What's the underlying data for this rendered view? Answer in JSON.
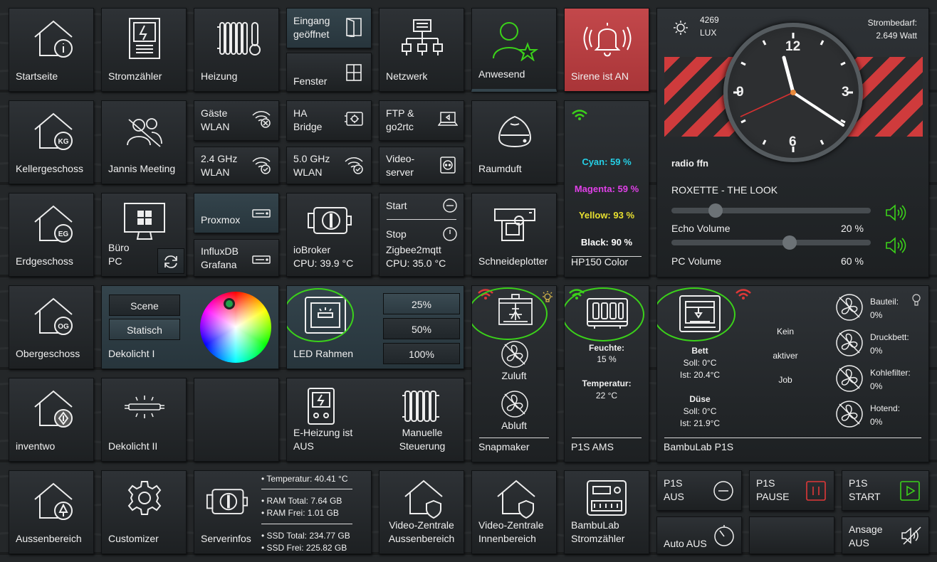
{
  "tiles": {
    "startseite": "Startseite",
    "stromzaehler": "Stromzähler",
    "heizung": "Heizung",
    "eingang": "Eingang geöffnet",
    "fenster": "Fenster",
    "netzwerk": "Netzwerk",
    "anwesend": "Anwesend",
    "sirene": "Sirene ist AN",
    "kellergeschoss": "Kellergeschoss",
    "jannis": "Jannis Meeting",
    "gaeste": "Gäste WLAN",
    "ha": "HA Bridge",
    "ftp": "FTP & go2rtc",
    "wlan24": "2.4 GHz WLAN",
    "wlan50": "5.0 GHz WLAN",
    "videoserver": "Video-server",
    "raumduft": "Raumduft",
    "erdgeschoss": "Erdgeschoss",
    "buero": "Büro PC",
    "proxmox": "Proxmox",
    "influx": "InfluxDB Grafana",
    "iobroker": "ioBroker",
    "iobroker_cpu": "CPU: 39.9 °C",
    "start": "Start",
    "stop": "Stop",
    "zigbee": "Zigbee2mqtt",
    "zigbee_cpu": "CPU: 35.0 °C",
    "schneideplotter": "Schneideplotter",
    "obergeschoss": "Obergeschoss",
    "dekolicht1": "Dekolicht I",
    "scene": "Scene",
    "statisch": "Statisch",
    "led": "LED Rahmen",
    "p25": "25%",
    "p50": "50%",
    "p100": "100%",
    "inventwo": "inventwo",
    "dekolicht2": "Dekolicht II",
    "eheizung": "E-Heizung ist AUS",
    "manuell": "Manuelle Steuerung",
    "aussenbereich": "Aussenbereich",
    "customizer": "Customizer",
    "serverinfos": "Serverinfos",
    "vz_aussen": "Video-Zentrale Aussenbereich",
    "vz_innen": "Video-Zentrale Innenbereich",
    "bambu_strom": "BambuLab Stromzähler"
  },
  "printer": {
    "cyan": "Cyan: 59 %",
    "magenta": "Magenta: 59 %",
    "yellow": "Yellow: 93 %",
    "black": "Black: 90 %",
    "name": "HP150 Color"
  },
  "radio": {
    "lux_value": "4269",
    "lux_unit": "LUX",
    "power_label": "Strombedarf:",
    "power_value": "2.649 Watt",
    "station": "radio ffn",
    "track": "ROXETTE - THE LOOK",
    "echo_label": "Echo Volume",
    "echo_value": "20 %",
    "echo_level": 0.2,
    "pc_label": "PC Volume",
    "pc_value": "60 %",
    "pc_level": 0.6,
    "clock_12": "12",
    "clock_3": "3",
    "clock_6": "6",
    "clock_9": "9"
  },
  "snapmaker": {
    "zuluft": "Zuluft",
    "abluft": "Abluft",
    "name": "Snapmaker"
  },
  "ams": {
    "feuchte_label": "Feuchte:",
    "feuchte_value": "15 %",
    "temp_label": "Temperatur:",
    "temp_value": "22 °C",
    "name": "P1S AMS"
  },
  "bambu": {
    "bett": "Bett",
    "bett_soll": "Soll: 0°C",
    "bett_ist": "Ist: 20.4°C",
    "duese": "Düse",
    "duese_soll": "Soll: 0°C",
    "duese_ist": "Ist: 21.9°C",
    "job1": "Kein",
    "job2": "aktiver",
    "job3": "Job",
    "bauteil": "Bauteil:",
    "bauteil_v": "0%",
    "druckbett": "Druckbett:",
    "druckbett_v": "0%",
    "kohle": "Kohlefilter:",
    "kohle_v": "0%",
    "hotend": "Hotend:",
    "hotend_v": "0%",
    "name": "BambuLab P1S"
  },
  "server": {
    "temp": "• Temperatur: 40.41 °C",
    "ram_total": "• RAM Total: 7.64 GB",
    "ram_free": "• RAM Frei: 1.01 GB",
    "ssd_total": "• SSD Total: 234.77 GB",
    "ssd_free": "• SSD Frei: 225.82 GB"
  },
  "p1s": {
    "aus": "P1S AUS",
    "pause": "P1S PAUSE",
    "start": "P1S START",
    "auto_aus": "Auto AUS",
    "ansage": "Ansage AUS"
  },
  "colors": {
    "accent_green": "#3bd21a",
    "red_tile": "#c3484b",
    "teal_tile": "#34444c"
  }
}
